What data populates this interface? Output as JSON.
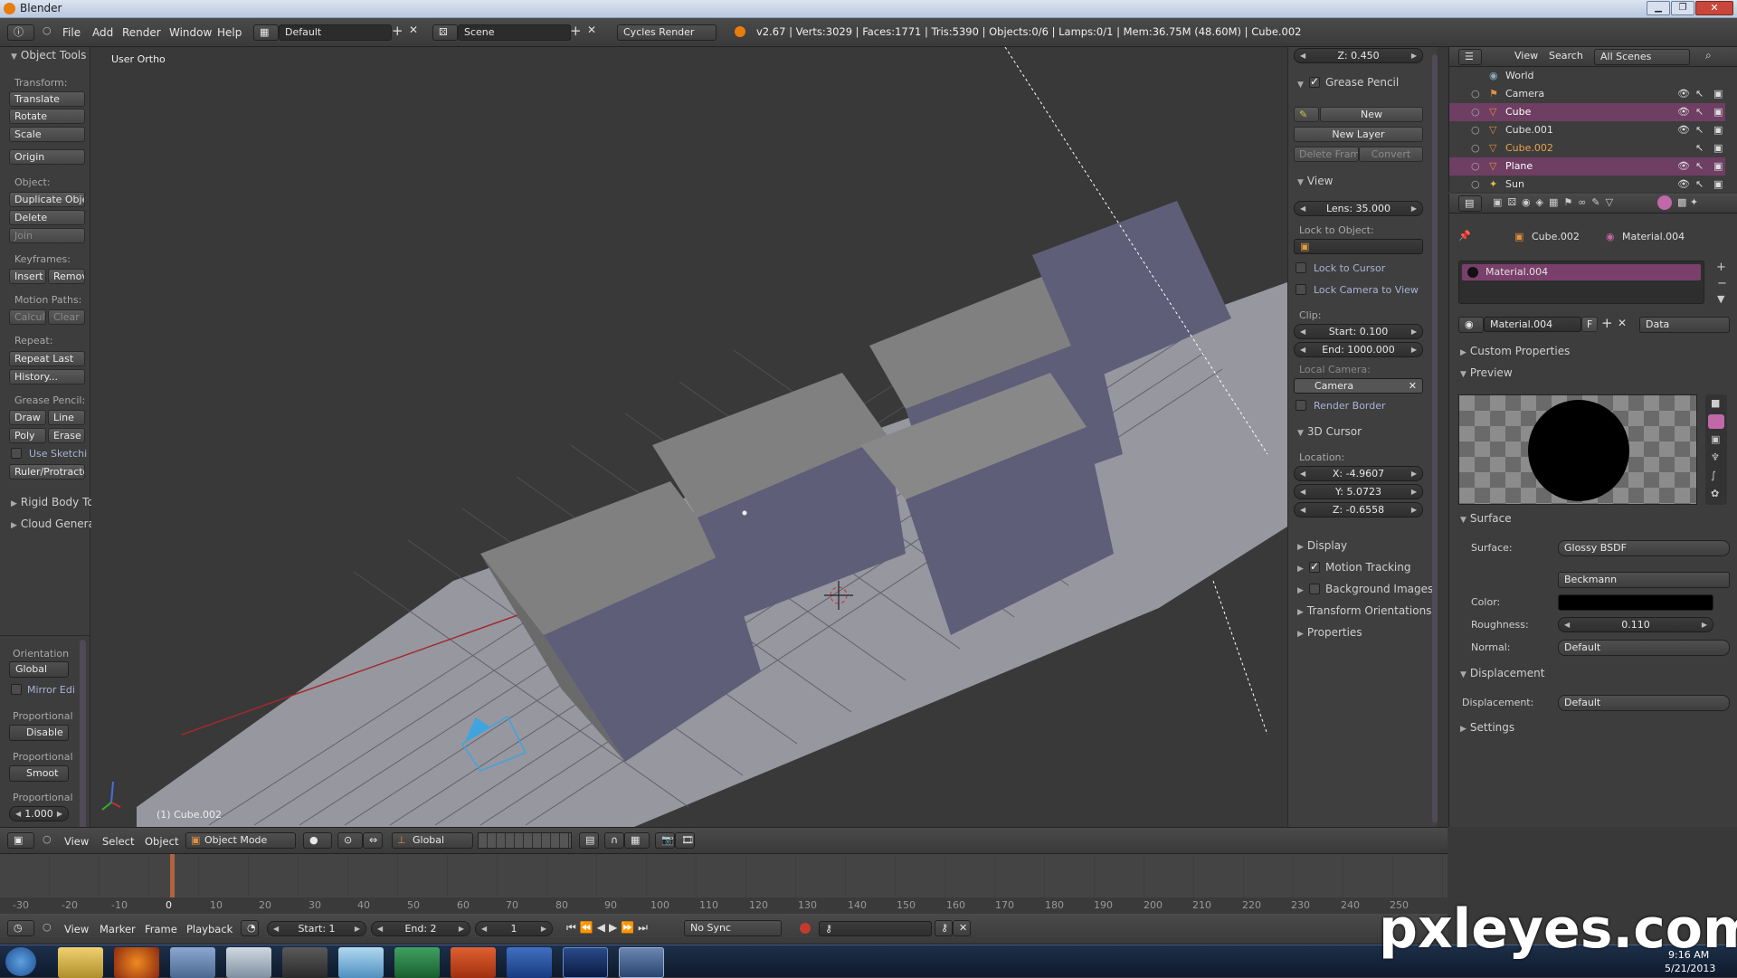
{
  "window": {
    "title": "Blender"
  },
  "infobar": {
    "menus": [
      "File",
      "Add",
      "Render",
      "Window",
      "Help"
    ],
    "layout": "Default",
    "scene": "Scene",
    "engine": "Cycles Render",
    "stats": "v2.67 | Verts:3029 | Faces:1771 | Tris:5390 | Objects:0/6 | Lamps:0/1 | Mem:36.75M (48.60M) | Cube.002"
  },
  "tool_shelf": {
    "panel_title": "Object Tools",
    "transform_label": "Transform:",
    "translate": "Translate",
    "rotate": "Rotate",
    "scale": "Scale",
    "origin": "Origin",
    "object_label": "Object:",
    "duplicate": "Duplicate Objec",
    "delete": "Delete",
    "join": "Join",
    "keyframes_label": "Keyframes:",
    "insert": "Insert",
    "remove": "Remov",
    "motion_paths_label": "Motion Paths:",
    "calculate": "Calcul",
    "clear": "Clear",
    "repeat_label": "Repeat:",
    "repeat_last": "Repeat Last",
    "history": "History...",
    "grease_pencil_label": "Grease Pencil:",
    "draw": "Draw",
    "line": "Line",
    "poly": "Poly",
    "erase": "Erase",
    "use_sketching": "Use Sketchi",
    "ruler": "Ruler/Protractor",
    "rigid_body": "Rigid Body To",
    "cloud": "Cloud Genera",
    "orientation_label": "Orientation",
    "orientation_value": "Global",
    "mirror": "Mirror Edi",
    "proportional_label": "Proportional",
    "proportional_value": "Disable",
    "falloff_label": "Proportional",
    "falloff_value": "Smoot",
    "size_label": "Proportional",
    "size_value": "1.000"
  },
  "viewport": {
    "view_name": "User Ortho",
    "active_object": "(1) Cube.002"
  },
  "properties_region": {
    "z_top": "Z: 0.450",
    "grease_pencil": "Grease Pencil",
    "gp_new": "New",
    "new_layer": "New Layer",
    "delete_frame": "Delete Frame",
    "convert": "Convert",
    "view": "View",
    "lens": "Lens: 35.000",
    "lock_to_object": "Lock to Object:",
    "lock_to_cursor": "Lock to Cursor",
    "lock_camera": "Lock Camera to View",
    "clip": "Clip:",
    "clip_start": "Start: 0.100",
    "clip_end": "End: 1000.000",
    "local_camera": "Local Camera:",
    "camera": "Camera",
    "render_border": "Render Border",
    "cursor3d": "3D Cursor",
    "location": "Location:",
    "cx": "X: -4.9607",
    "cy": "Y: 5.0723",
    "cz": "Z: -0.6558",
    "display": "Display",
    "motion_tracking": "Motion Tracking",
    "background_images": "Background Images",
    "transform_orientations": "Transform Orientations",
    "properties": "Properties"
  },
  "outliner": {
    "view": "View",
    "search": "Search",
    "filter": "All Scenes",
    "items": [
      {
        "name": "World"
      },
      {
        "name": "Camera"
      },
      {
        "name": "Cube"
      },
      {
        "name": "Cube.001"
      },
      {
        "name": "Cube.002"
      },
      {
        "name": "Plane"
      },
      {
        "name": "Sun"
      }
    ]
  },
  "material": {
    "object": "Cube.002",
    "material": "Material.004",
    "slot": "Material.004",
    "datablock": "Material.004",
    "F": "F",
    "link": "Data",
    "custom_properties": "Custom Properties",
    "preview": "Preview",
    "surface_panel": "Surface",
    "surface_label": "Surface:",
    "surface_value": "Glossy BSDF",
    "distribution": "Beckmann",
    "color_label": "Color:",
    "roughness_label": "Roughness:",
    "roughness_value": "0.110",
    "normal_label": "Normal:",
    "normal_value": "Default",
    "displacement_panel": "Displacement",
    "displacement_label": "Displacement:",
    "displacement_value": "Default",
    "settings": "Settings"
  },
  "view3d_header": {
    "view": "View",
    "select": "Select",
    "object": "Object",
    "mode": "Object Mode",
    "orientation": "Global"
  },
  "timeline": {
    "ticks": [
      "-30",
      "-20",
      "-10",
      "0",
      "10",
      "20",
      "30",
      "40",
      "50",
      "60",
      "70",
      "80",
      "90",
      "100",
      "110",
      "120",
      "130",
      "140",
      "150",
      "160",
      "170",
      "180",
      "190",
      "200",
      "210",
      "220",
      "230",
      "240",
      "250"
    ],
    "view": "View",
    "marker": "Marker",
    "frame": "Frame",
    "playback": "Playback",
    "start": "Start: 1",
    "end": "End: 2",
    "current": "1",
    "sync": "No Sync"
  },
  "taskbar": {
    "time": "9:16 AM",
    "date": "5/21/2013"
  },
  "watermark": "pxleyes.com",
  "colors": {
    "selected_row": "#6e3e63",
    "accent_blue": "#5680c2",
    "material_slot": "#7a3f6a"
  }
}
